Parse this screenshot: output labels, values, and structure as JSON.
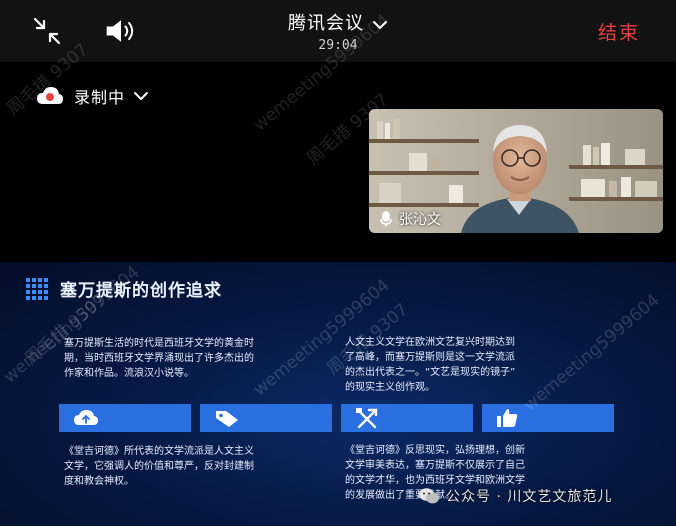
{
  "meeting": {
    "title": "腾讯会议",
    "timer": "29:04",
    "end_label": "结束"
  },
  "recording": {
    "label": "录制中"
  },
  "participant": {
    "name": "张沁文"
  },
  "watermark": {
    "account": "wemeeting5999604",
    "name": "周毛措 9307"
  },
  "slide": {
    "title": "塞万提斯的创作追求",
    "p1": [
      "塞万提斯生活的时代是西班牙文学的黄金时",
      "期，当时西班牙文学界涌现出了许多杰出的",
      "作家和作品。流浪汉小说等。"
    ],
    "p2": [
      "人文主义文学在欧洲文艺复兴时期达到",
      "了高峰，而塞万提斯则是这一文学流派",
      "的杰出代表之一。“文艺是现实的镜子”",
      "的现实主义创作观。"
    ],
    "p3": [
      "《堂吉诃德》所代表的文学流派是人文主义",
      "文学，它强调人的价值和尊严，反对封建制",
      "度和教会神权。"
    ],
    "p4": [
      "《堂吉诃德》反思现实，弘扬理想，创新",
      "文学审美表达，塞万提斯不仅展示了自己",
      "的文学才华，也为西班牙文学和欧洲文学",
      "的发展做出了重要贡献。"
    ]
  },
  "footer": {
    "account": "公众号 · 川文艺文旅范儿"
  },
  "colors": {
    "end": "#e8423c",
    "accent": "#2a6fe0",
    "slide_bg": "#071a45"
  }
}
